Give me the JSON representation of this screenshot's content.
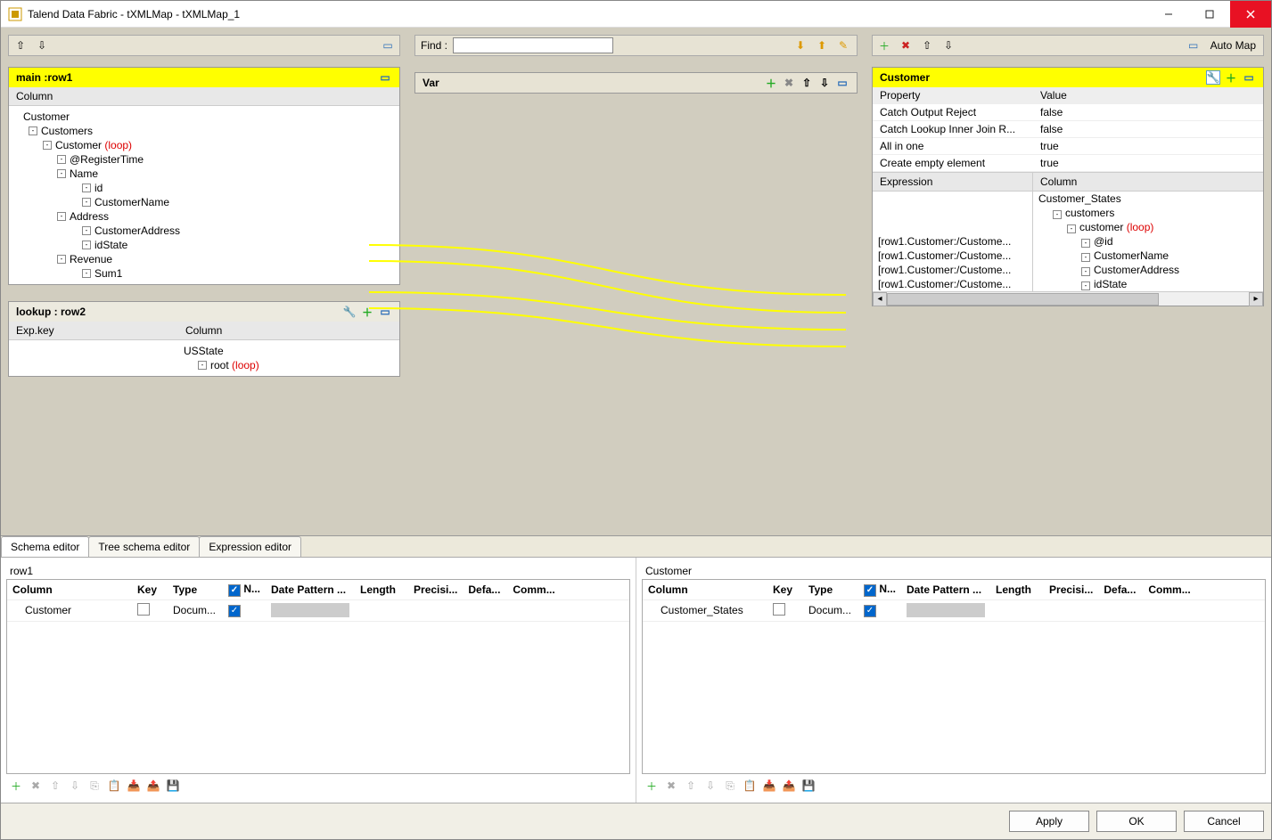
{
  "window": {
    "title": "Talend Data Fabric - tXMLMap - tXMLMap_1"
  },
  "inputs": {
    "main": {
      "title": "main :row1",
      "column_header": "Column",
      "root": "Customer",
      "tree": [
        {
          "ind": 1,
          "tog": "-",
          "label": "Customers"
        },
        {
          "ind": 2,
          "tog": "-",
          "label": "Customer",
          "loop": "(loop)"
        },
        {
          "ind": 3,
          "tog": "-",
          "label": "@RegisterTime"
        },
        {
          "ind": 3,
          "tog": "-",
          "label": "Name"
        },
        {
          "ind": 4,
          "tog": "-",
          "label": "id"
        },
        {
          "ind": 4,
          "tog": "-",
          "label": "CustomerName"
        },
        {
          "ind": 3,
          "tog": "-",
          "label": "Address"
        },
        {
          "ind": 4,
          "tog": "-",
          "label": "CustomerAddress"
        },
        {
          "ind": 4,
          "tog": "-",
          "label": "idState"
        },
        {
          "ind": 3,
          "tog": "-",
          "label": "Revenue"
        },
        {
          "ind": 4,
          "tog": "-",
          "label": "Sum1"
        }
      ]
    },
    "lookup": {
      "title": "lookup : row2",
      "expkey_header": "Exp.key",
      "column_header": "Column",
      "root": "USState",
      "tree": [
        {
          "ind": 1,
          "tog": "-",
          "label": "root",
          "loop": "(loop)"
        }
      ]
    }
  },
  "middle": {
    "find_label": "Find :",
    "var_label": "Var"
  },
  "output": {
    "title": "Customer",
    "auto_map_label": "Auto Map",
    "props_header": {
      "property": "Property",
      "value": "Value"
    },
    "props": [
      {
        "k": "Catch Output Reject",
        "v": "false"
      },
      {
        "k": "Catch Lookup Inner Join R...",
        "v": "false"
      },
      {
        "k": "All in one",
        "v": "true"
      },
      {
        "k": "Create empty element",
        "v": "true"
      }
    ],
    "expr_header": {
      "expr": "Expression",
      "col": "Column"
    },
    "root": "Customer_States",
    "tree": [
      {
        "ind": 1,
        "tog": "-",
        "label": "customers"
      },
      {
        "ind": 2,
        "tog": "-",
        "label": "customer",
        "loop": "(loop)"
      },
      {
        "expr": "[row1.Customer:/Custome...",
        "ind": 3,
        "tog": "-",
        "label": "@id"
      },
      {
        "expr": "[row1.Customer:/Custome...",
        "ind": 3,
        "tog": "-",
        "label": "CustomerName"
      },
      {
        "expr": "[row1.Customer:/Custome...",
        "ind": 3,
        "tog": "-",
        "label": "CustomerAddress"
      },
      {
        "expr": "[row1.Customer:/Custome...",
        "ind": 3,
        "tog": "-",
        "label": "idState"
      }
    ]
  },
  "bottom": {
    "tabs": [
      "Schema editor",
      "Tree schema editor",
      "Expression editor"
    ],
    "left": {
      "title": "row1",
      "columns": [
        "Column",
        "Key",
        "Type",
        "N...",
        "Date Pattern ...",
        "Length",
        "Precisi...",
        "Defa...",
        "Comm..."
      ],
      "row": {
        "col": "Customer",
        "key": false,
        "type": "Docum...",
        "n": true
      }
    },
    "right": {
      "title": "Customer",
      "columns": [
        "Column",
        "Key",
        "Type",
        "N...",
        "Date Pattern ...",
        "Length",
        "Precisi...",
        "Defa...",
        "Comm..."
      ],
      "row": {
        "col": "Customer_States",
        "key": false,
        "type": "Docum...",
        "n": true
      }
    }
  },
  "footer": {
    "apply": "Apply",
    "ok": "OK",
    "cancel": "Cancel"
  }
}
